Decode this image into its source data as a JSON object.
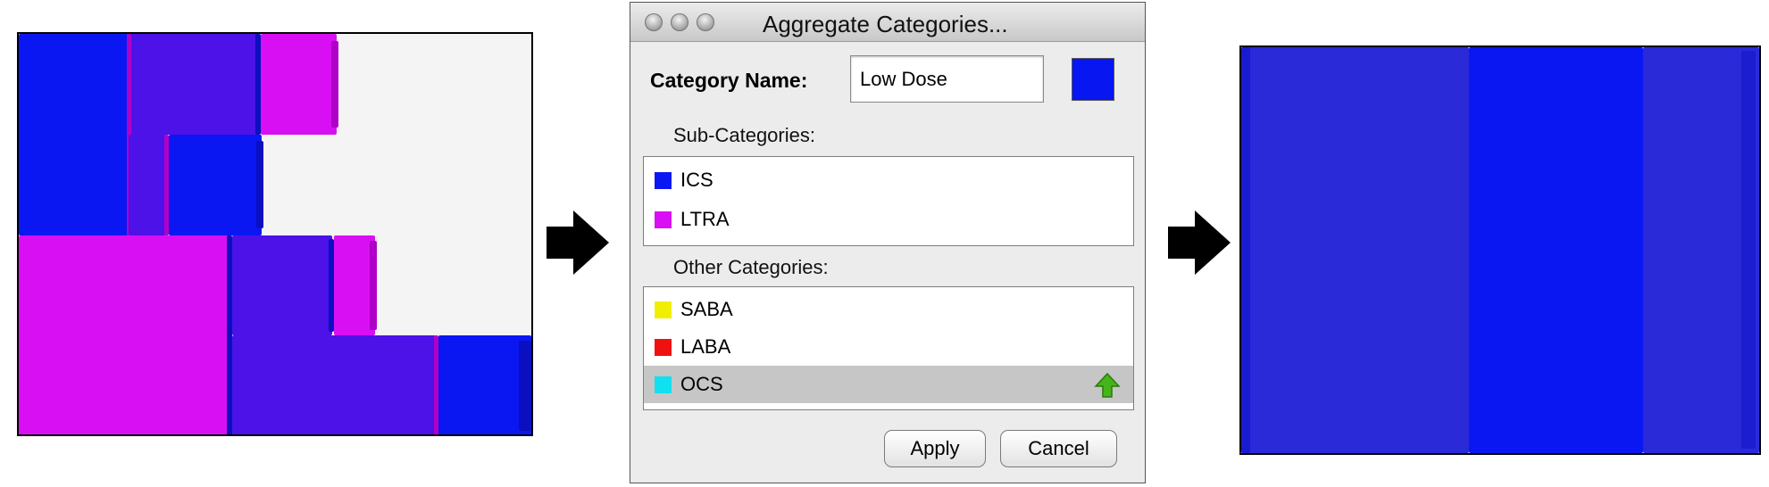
{
  "colors": {
    "ics_blue": "#0b17f2",
    "ltra_magenta": "#d90ff3",
    "indigo_mix": "#4c12e8",
    "aggregate_blue": "#0816f2",
    "saba_yellow": "#f0ef00",
    "laba_red": "#f01010",
    "ocs_cyan": "#10e0f0",
    "arrow_green": "#45b51a"
  },
  "dialog": {
    "title": "Aggregate Categories...",
    "category_name_label": "Category Name:",
    "category_name_value": "Low Dose",
    "color_swatch": "#0816f2",
    "sub_categories_label": "Sub-Categories:",
    "sub_categories": [
      {
        "label": "ICS",
        "color": "#0b17f2"
      },
      {
        "label": "LTRA",
        "color": "#d90ff3"
      }
    ],
    "other_categories_label": "Other Categories:",
    "other_categories": [
      {
        "label": "SABA",
        "color": "#f0ef00",
        "selected": false
      },
      {
        "label": "LABA",
        "color": "#f01010",
        "selected": false
      },
      {
        "label": "OCS",
        "color": "#10e0f0",
        "selected": true
      }
    ],
    "move_up_icon": "green-up-arrow-icon",
    "apply_label": "Apply",
    "cancel_label": "Cancel"
  },
  "arrows": [
    "right-arrow-icon",
    "right-arrow-icon"
  ]
}
